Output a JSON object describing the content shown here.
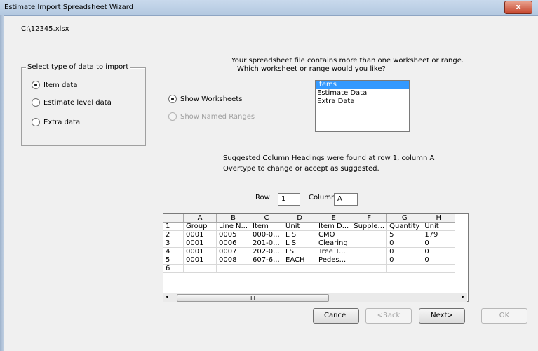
{
  "window": {
    "title": "Estimate Import Spreadsheet Wizard",
    "close_glyph": "x"
  },
  "file_path": "C:\\12345.xlsx",
  "prompt": {
    "line1": "Your spreadsheet file contains more than one worksheet or range.",
    "line2": "Which worksheet or range would you like?"
  },
  "import_type": {
    "legend": "Select type of data to import",
    "options": [
      {
        "label": "Item data",
        "checked": true
      },
      {
        "label": "Estimate level data",
        "checked": false
      },
      {
        "label": "Extra data",
        "checked": false
      }
    ]
  },
  "source": {
    "show_worksheets": "Show Worksheets",
    "show_named_ranges": "Show Named Ranges",
    "worksheets": [
      "Items",
      "Estimate Data",
      "Extra Data"
    ],
    "selected_index": 0
  },
  "suggestion": {
    "line1": "Suggested Column Headings were found at row 1, column A",
    "line2": "Overtype to change or accept as suggested."
  },
  "position": {
    "row_label": "Row",
    "row_value": "1",
    "column_label": "Column",
    "column_value": "A"
  },
  "grid": {
    "columns": [
      "",
      "A",
      "B",
      "C",
      "D",
      "E",
      "F",
      "G",
      "H"
    ],
    "rows": [
      [
        "1",
        "Group",
        "Line N...",
        "Item",
        "Unit",
        "Item D...",
        "Supple...",
        "Quantity",
        "Unit"
      ],
      [
        "2",
        "0001",
        "0005",
        "000-0...",
        "L S",
        "CMO",
        "",
        "5",
        "179"
      ],
      [
        "3",
        "0001",
        "0006",
        "201-0...",
        "L S",
        "Clearing",
        "",
        "0",
        "0"
      ],
      [
        "4",
        "0001",
        "0007",
        "202-0...",
        "LS",
        "Tree T...",
        "",
        "0",
        "0"
      ],
      [
        "5",
        "0001",
        "0008",
        "607-6...",
        "EACH",
        "Pedes...",
        "",
        "0",
        "0"
      ],
      [
        "6",
        "",
        "",
        "",
        "",
        "",
        "",
        "",
        ""
      ]
    ],
    "scroll_thumb_glyph": "III"
  },
  "buttons": {
    "cancel": "Cancel",
    "back": "<Back",
    "next": "Next>",
    "ok": "OK"
  }
}
